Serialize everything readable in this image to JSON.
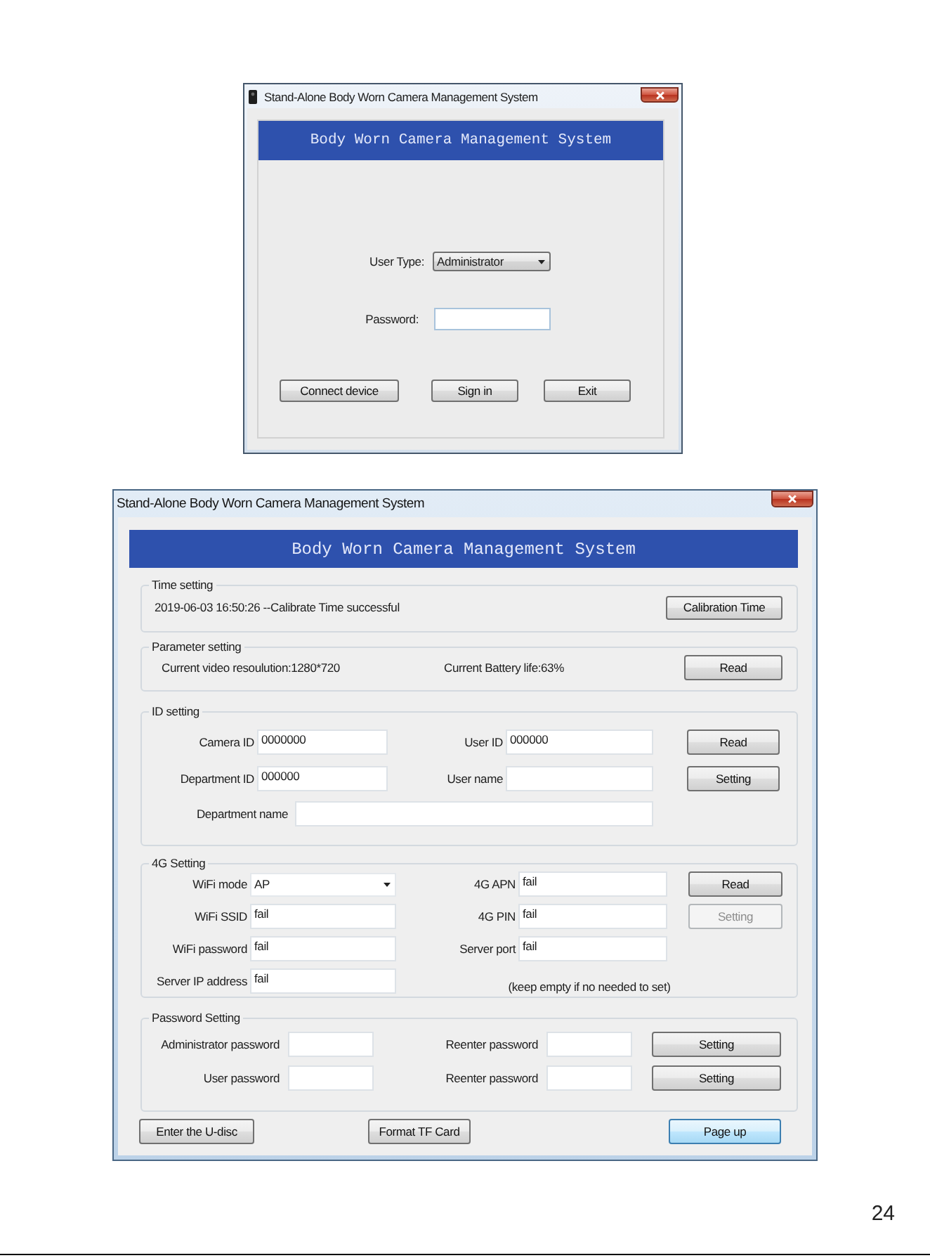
{
  "login_window": {
    "title": "Stand-Alone Body Worn Camera Management System",
    "banner": "Body Worn Camera Management System",
    "user_type": {
      "label": "User Type:",
      "value": "Administrator"
    },
    "password": {
      "label": "Password:"
    },
    "buttons": [
      "Connect device",
      "Sign in",
      "Exit"
    ]
  },
  "settings_window": {
    "title": "Stand-Alone Body Worn Camera Management System",
    "banner": "Body Worn Camera Management System",
    "time_setting": {
      "title": "Time setting",
      "status": "2019-06-03 16:50:26 --Calibrate Time successful",
      "button": "Calibration Time"
    },
    "parameter_setting": {
      "title": "Parameter setting",
      "resolution": "Current video resoulution:1280*720",
      "battery": "Current Battery life:63%",
      "button": "Read"
    },
    "id_setting": {
      "title": "ID setting",
      "fields": [
        {
          "label": "Camera ID",
          "value": "0000000"
        },
        {
          "label": "User ID",
          "value": "000000"
        },
        {
          "label": "Department ID",
          "value": "000000"
        },
        {
          "label": "User name"
        },
        {
          "label": "Department name"
        }
      ],
      "buttons": [
        "Read",
        "Setting"
      ]
    },
    "g4_setting": {
      "title": "4G Setting",
      "fields": [
        {
          "kind": "dropdown",
          "label": "WiFi mode",
          "value": "AP"
        },
        {
          "kind": "text",
          "label": "4G APN",
          "value": "fail"
        },
        {
          "kind": "text",
          "label": "WiFi SSID",
          "value": "fail"
        },
        {
          "kind": "text",
          "label": "4G PIN",
          "value": "fail"
        },
        {
          "kind": "text",
          "label": "WiFi password",
          "value": "fail"
        },
        {
          "kind": "text",
          "label": "Server port",
          "value": "fail"
        },
        {
          "kind": "text",
          "label": "Server IP address",
          "value": "fail"
        }
      ],
      "note": "(keep empty if no needed to set)",
      "buttons": [
        {
          "label": "Read",
          "disabled": false
        },
        {
          "label": "Setting",
          "disabled": true
        }
      ]
    },
    "password_setting": {
      "title": "Password Setting",
      "rows": [
        {
          "label": "Administrator password",
          "confirm_label": "Reenter password",
          "button": "Setting"
        },
        {
          "label": "User password",
          "confirm_label": "Reenter password",
          "button": "Setting"
        }
      ]
    },
    "footer_buttons": [
      {
        "label": "Enter the U-disc",
        "focused": false
      },
      {
        "label": "Format TF Card",
        "focused": false
      },
      {
        "label": "Page up",
        "focused": true
      }
    ]
  },
  "page_number": "24"
}
